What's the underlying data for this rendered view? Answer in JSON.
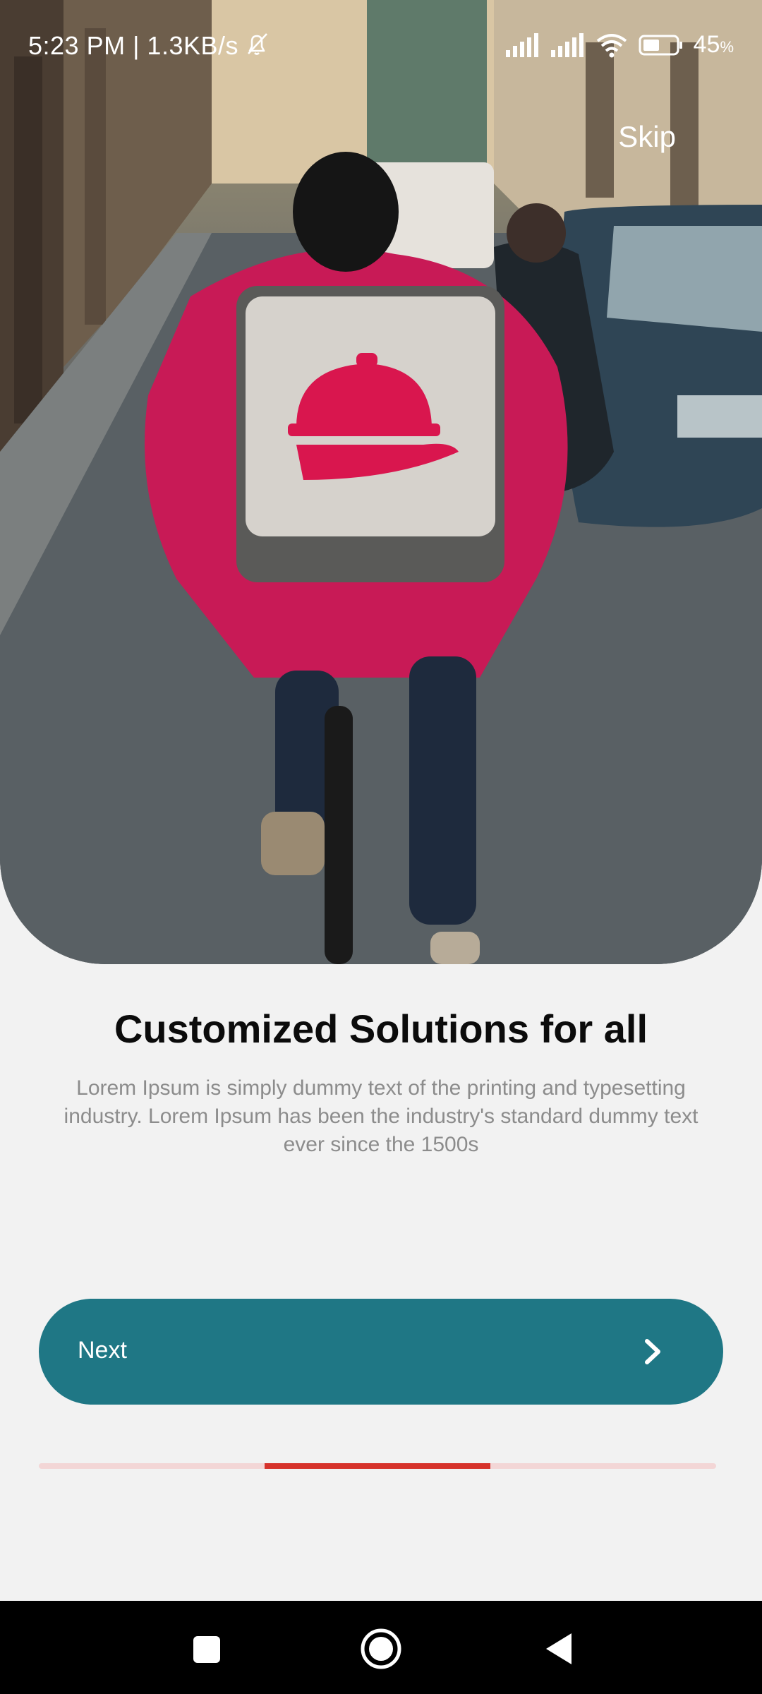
{
  "status_bar": {
    "time_speed": "5:23 PM | 1.3KB/s",
    "battery_value": "45",
    "battery_unit": "%",
    "icons": [
      "bell-off-icon",
      "signal-icon",
      "signal-icon",
      "wifi-icon",
      "battery-icon"
    ]
  },
  "onboarding": {
    "skip_label": "Skip",
    "title": "Customized Solutions for all",
    "description": "Lorem Ipsum is simply dummy text of the printing and typesetting industry. Lorem Ipsum has been the industry's standard dummy text ever since the 1500s",
    "next_label": "Next",
    "next_icon": "chevron-right-icon",
    "progress": {
      "total_steps": 3,
      "current_step": 2
    }
  },
  "nav_bar": {
    "buttons": [
      "recents-icon",
      "home-icon",
      "back-icon"
    ]
  },
  "colors": {
    "accent": "#1f7785",
    "progress_active": "#d6322b",
    "progress_track": "#f3d6d6",
    "background": "#f2f2f2",
    "backpack": "#d9164e"
  }
}
